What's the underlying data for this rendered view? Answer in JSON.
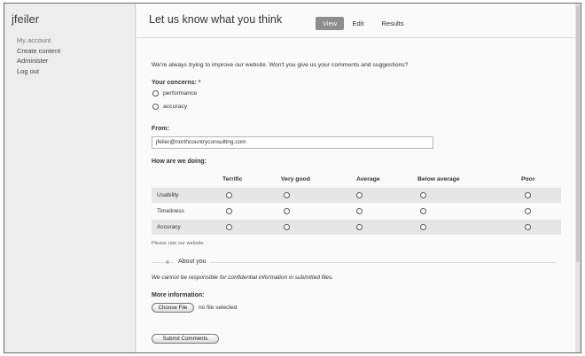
{
  "sidebar": {
    "site_name": "jfeiler",
    "items": [
      {
        "label": "My account"
      },
      {
        "label": "Create content"
      },
      {
        "label": "Administer"
      },
      {
        "label": "Log out"
      }
    ]
  },
  "page": {
    "title": "Let us know what you think",
    "tabs": [
      {
        "label": "View",
        "active": true
      },
      {
        "label": "Edit",
        "active": false
      },
      {
        "label": "Results",
        "active": false
      }
    ]
  },
  "form": {
    "intro": "We're always trying to improve our website. Won't you give us your comments and suggestions?",
    "concern_label": "Your concerns:",
    "required_marker": "*",
    "concern_options": [
      "performance",
      "accuracy"
    ],
    "from_label": "From:",
    "from_value": "jfeiler@northcountryconsulting.com",
    "rating_label": "How are we doing:",
    "rating_columns": [
      "Terrific",
      "Very good",
      "Average",
      "Below average",
      "Poor"
    ],
    "rating_rows": [
      "Usability",
      "Timeliness",
      "Accuracy"
    ],
    "rating_help": "Please rate our website.",
    "about_you": "About you",
    "disclaimer": "We cannot be responsible for confidential information in submitted files.",
    "more_info_label": "More information:",
    "choose_file_button": "Choose File",
    "no_file_text": "no file selected",
    "submit_button": "Submit Comments"
  }
}
